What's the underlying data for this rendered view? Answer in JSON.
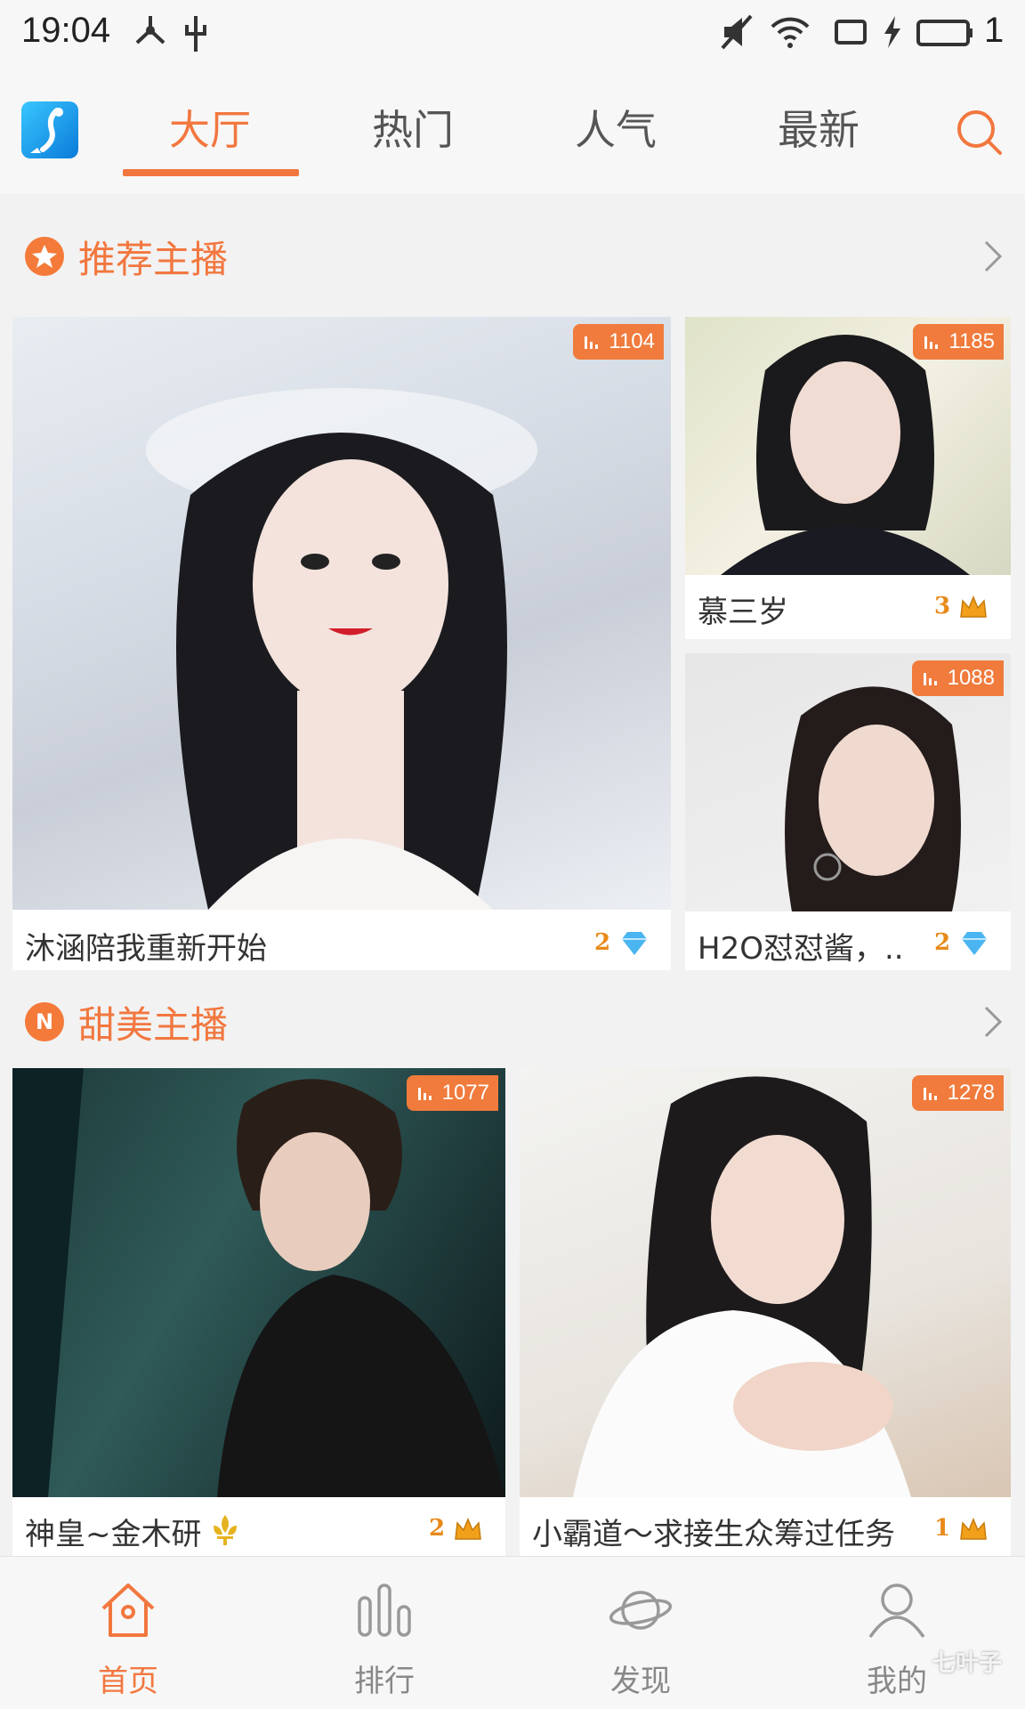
{
  "status_bar": {
    "time": "19:04",
    "battery": "1"
  },
  "top_tabs": {
    "tabs": [
      {
        "label": "大厅",
        "active": true
      },
      {
        "label": "热门",
        "active": false
      },
      {
        "label": "人气",
        "active": false
      },
      {
        "label": "最新",
        "active": false
      }
    ],
    "accent_color": "#f2773f"
  },
  "sections": {
    "recommended": {
      "title": "推荐主播",
      "badge_icon": "star-icon",
      "cards": [
        {
          "name": "沐涵陪我重新开始",
          "viewers": "1104",
          "level": "2",
          "level_icon": "diamond-icon"
        },
        {
          "name": "慕三岁",
          "viewers": "1185",
          "level": "3",
          "level_icon": "crown-icon"
        },
        {
          "name": "H2O怼怼酱，..",
          "viewers": "1088",
          "level": "2",
          "level_icon": "diamond-icon"
        }
      ]
    },
    "sweet": {
      "title": "甜美主播",
      "badge_text": "N",
      "cards": [
        {
          "name": "神皇~金木研",
          "viewers": "1077",
          "level": "2",
          "level_icon": "crown-icon"
        },
        {
          "name": "小霸道～求接生众筹过任务",
          "viewers": "1278",
          "level": "1",
          "level_icon": "crown-icon"
        }
      ]
    }
  },
  "bottom_nav": {
    "items": [
      {
        "label": "首页",
        "icon": "home-icon",
        "active": true
      },
      {
        "label": "排行",
        "icon": "ranking-icon",
        "active": false
      },
      {
        "label": "发现",
        "icon": "planet-icon",
        "active": false
      },
      {
        "label": "我的",
        "icon": "user-icon",
        "active": false
      }
    ]
  },
  "watermark": "七叶子"
}
